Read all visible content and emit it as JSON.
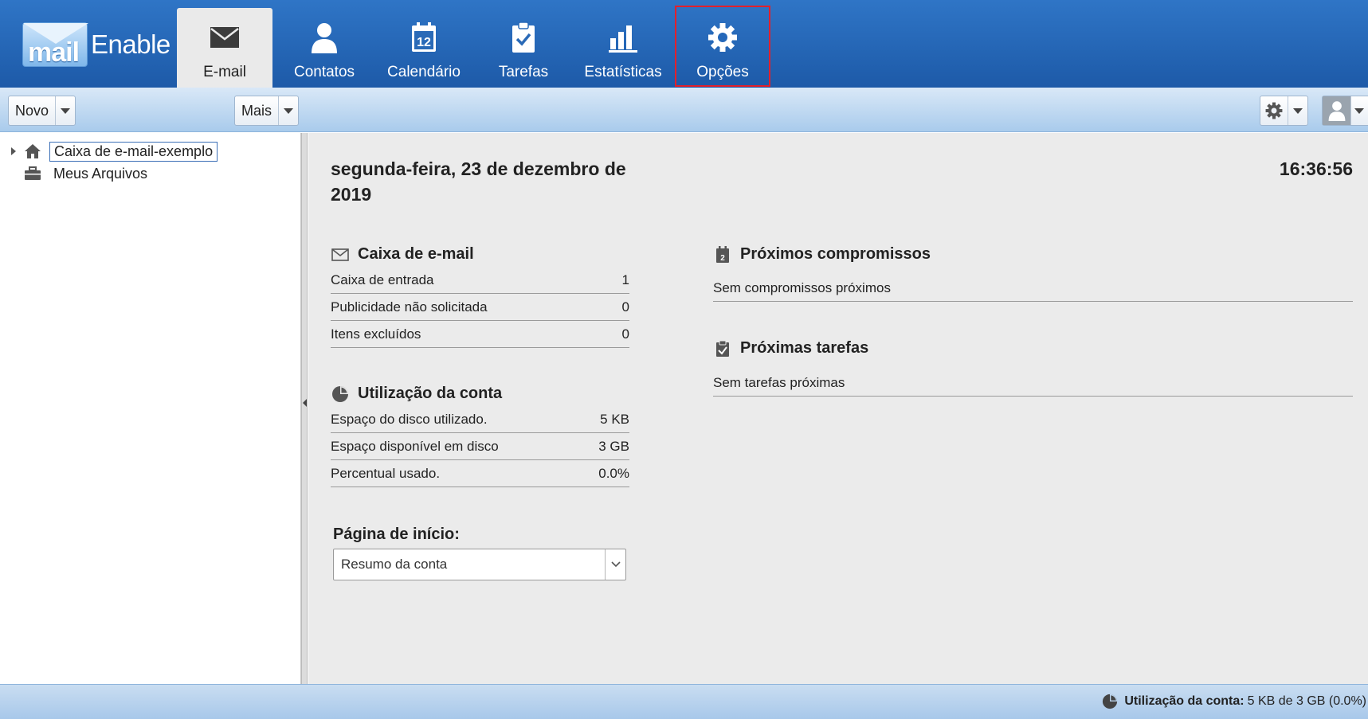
{
  "app": {
    "logo_part1": "mail",
    "logo_part2": "Enable"
  },
  "nav": {
    "tabs": [
      {
        "label": "E-mail",
        "icon": "envelope-icon",
        "active": true
      },
      {
        "label": "Contatos",
        "icon": "person-icon"
      },
      {
        "label": "Calendário",
        "icon": "calendar-icon",
        "icon_text": "12"
      },
      {
        "label": "Tarefas",
        "icon": "clipboard-check-icon"
      },
      {
        "label": "Estatísticas",
        "icon": "bar-chart-icon"
      },
      {
        "label": "Opções",
        "icon": "gear-icon",
        "highlighted": true
      }
    ]
  },
  "toolbar": {
    "new_label": "Novo",
    "more_label": "Mais",
    "settings_icon": "gear-icon",
    "user_icon": "user-icon"
  },
  "tree": {
    "items": [
      {
        "label": "Caixa de e-mail-exemplo",
        "icon": "home-icon",
        "selected": true,
        "expandable": true
      },
      {
        "label": "Meus Arquivos",
        "icon": "briefcase-icon"
      }
    ]
  },
  "summary": {
    "date": "segunda-feira, 23 de dezembro de 2019",
    "time": "16:36:56",
    "mailbox": {
      "title": "Caixa de e-mail",
      "rows": [
        {
          "label": "Caixa de entrada",
          "value": "1"
        },
        {
          "label": "Publicidade não solicitada",
          "value": "0"
        },
        {
          "label": "Itens excluídos",
          "value": "0"
        }
      ]
    },
    "usage": {
      "title": "Utilização da conta",
      "rows": [
        {
          "label": "Espaço do disco utilizado.",
          "value": "5 KB"
        },
        {
          "label": "Espaço disponível em disco",
          "value": "3 GB"
        },
        {
          "label": "Percentual usado.",
          "value": "0.0%"
        }
      ]
    },
    "appointments": {
      "title": "Próximos compromissos",
      "empty": "Sem compromissos próximos"
    },
    "tasks": {
      "title": "Próximas tarefas",
      "empty": "Sem tarefas próximas"
    },
    "start_page": {
      "label": "Página de início:",
      "value": "Resumo da conta"
    }
  },
  "status": {
    "usage_label": "Utilização da conta:",
    "usage_value": "5 KB de 3 GB (0.0%)"
  },
  "colors": {
    "nav_bg": "#2f75c6",
    "highlight_border": "#e3202b",
    "content_bg": "#ebebeb"
  }
}
